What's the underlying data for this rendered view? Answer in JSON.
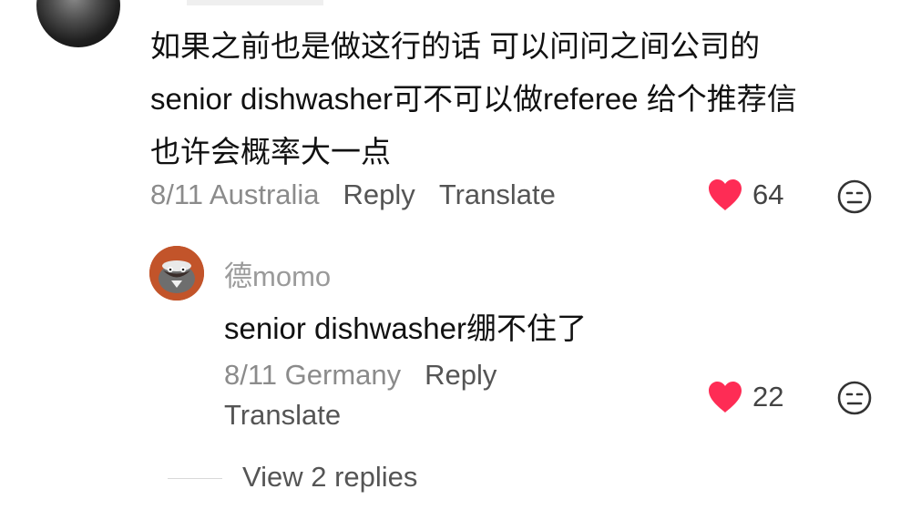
{
  "comment": {
    "lines": [
      "如果之前也是做这行的话 可以问问之间公司的",
      "senior dishwasher可不可以做referee 给个推荐信",
      "也许会概率大一点"
    ],
    "date_location": "8/11 Australia",
    "reply_label": "Reply",
    "translate_label": "Translate",
    "like_count": "64",
    "avatar_icon": "avatar-image",
    "like_icon": "heart-icon",
    "dislike_icon": "neutral-face-icon",
    "like_color": "#fe2c55"
  },
  "reply": {
    "username": "德momo",
    "text": "senior dishwasher绷不住了",
    "date_location": "8/11 Germany",
    "reply_label": "Reply",
    "translate_label": "Translate",
    "like_count": "22",
    "avatar_color": "#c2542a"
  },
  "view_replies_label": "View 2 replies"
}
